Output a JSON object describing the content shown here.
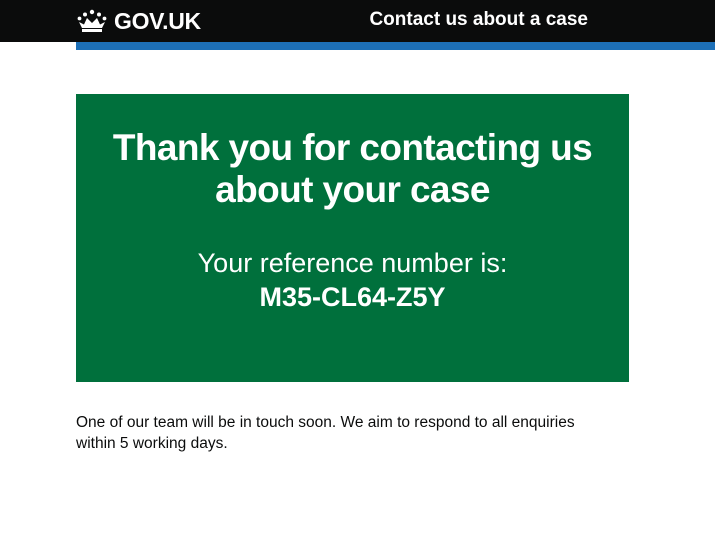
{
  "header": {
    "logo_text": "GOV.UK",
    "logo_icon": "crown-icon",
    "service_name": "Contact us about a case",
    "background_color": "#0b0c0c",
    "stripe_color": "#1d70b8"
  },
  "confirmation_panel": {
    "title": "Thank you for contacting us about your case",
    "reference_label": "Your reference number is:",
    "reference_number": "M35-CL64-Z5Y",
    "background_color": "#00703c"
  },
  "main": {
    "body_text": "One of our team will be in touch soon. We aim to respond to all enquiries within 5 working days."
  }
}
